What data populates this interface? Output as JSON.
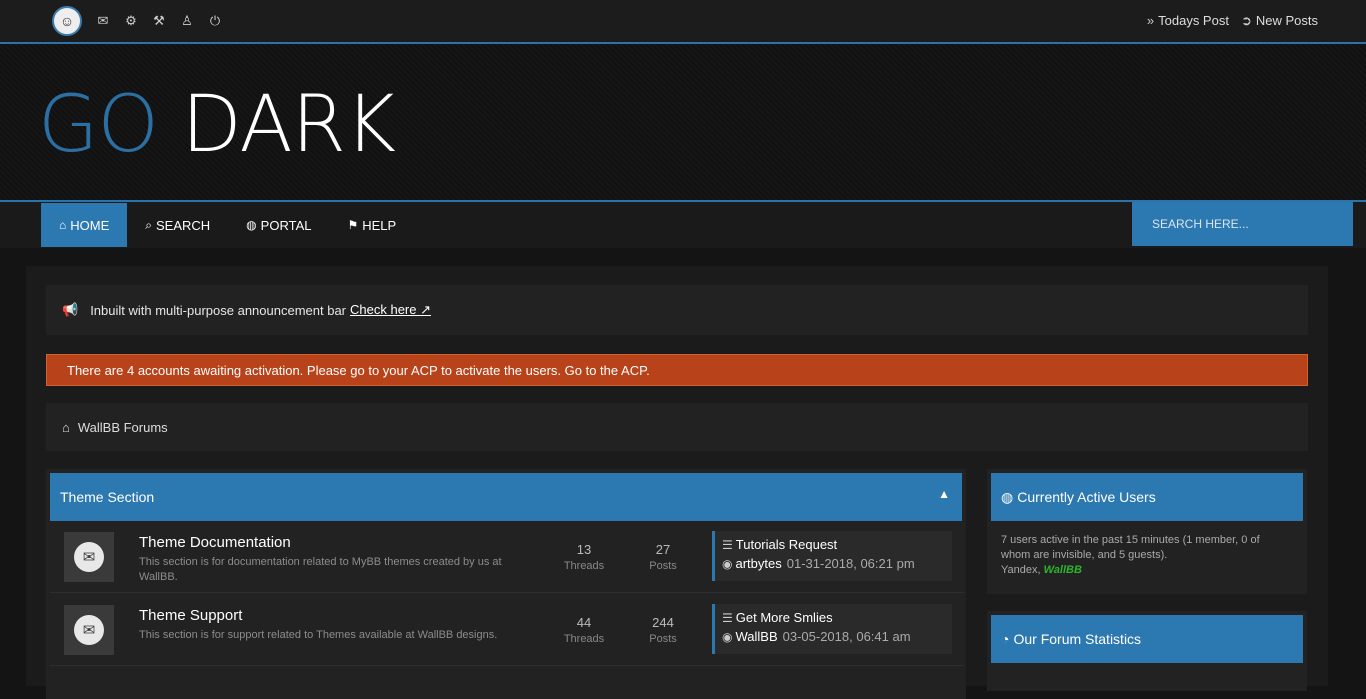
{
  "topbar": {
    "icons": [
      "avatar",
      "envelope-icon",
      "cogs-icon",
      "gavel-icon",
      "user-secret-icon",
      "power-icon"
    ],
    "links": [
      {
        "icon": "double-chevron-right-icon",
        "label": "Todays Post"
      },
      {
        "icon": "arrow-circle-right-icon",
        "label": "New Posts"
      }
    ]
  },
  "logo": {
    "go": "GO",
    "dark": "DARK"
  },
  "nav": {
    "items": [
      {
        "label": "HOME",
        "icon": "home-icon",
        "active": true
      },
      {
        "label": "SEARCH",
        "icon": "search-icon"
      },
      {
        "label": "PORTAL",
        "icon": "globe-icon"
      },
      {
        "label": "HELP",
        "icon": "flag-icon"
      }
    ],
    "search_placeholder": "SEARCH HERE..."
  },
  "announcement": {
    "text": "Inbuilt with multi-purpose announcement bar",
    "link": "Check here"
  },
  "alert": {
    "text": "There are 4 accounts awaiting activation. Please go to your ACP to activate the users. Go to the ACP."
  },
  "breadcrumb": {
    "label": "WallBB Forums"
  },
  "forums": {
    "section_title": "Theme Section",
    "rows": [
      {
        "title": "Theme Documentation",
        "desc": "This section is for documentation related to MyBB themes created by us at WallBB.",
        "threads": "13",
        "threads_label": "Threads",
        "posts": "27",
        "posts_label": "Posts",
        "last_title": "Tutorials Request",
        "last_user": "artbytes",
        "last_date": "01-31-2018, 06:21 pm"
      },
      {
        "title": "Theme Support",
        "desc": "This section is for support related to Themes available at WallBB designs.",
        "threads": "44",
        "threads_label": "Threads",
        "posts": "244",
        "posts_label": "Posts",
        "last_title": "Get More Smlies",
        "last_user": "WallBB",
        "last_date": "03-05-2018, 06:41 am"
      }
    ]
  },
  "sidebar": {
    "active_users": {
      "title": "Currently Active Users",
      "text": "7 users active in the past 15 minutes (1 member, 0 of whom are invisible, and 5 guests).",
      "bots": "Yandex,",
      "member": "WallBB"
    },
    "stats": {
      "title": "Our Forum Statistics"
    }
  },
  "colors": {
    "accent": "#2c78b0",
    "alert": "#b8431a",
    "member": "#2bb52b"
  }
}
